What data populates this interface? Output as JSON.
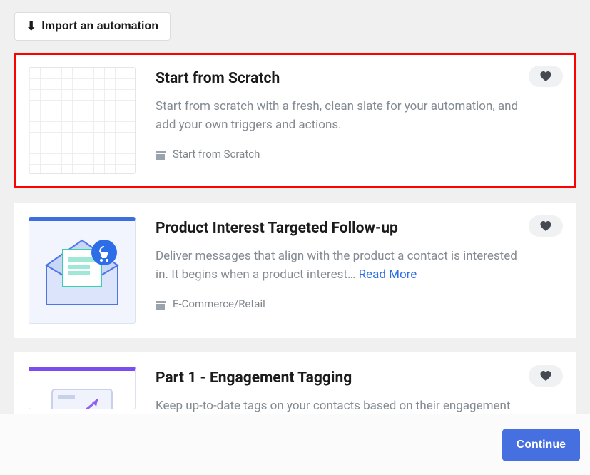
{
  "import_button": "Import an automation",
  "continue_button": "Continue",
  "read_more": "Read More",
  "cards": [
    {
      "title": "Start from Scratch",
      "description": "Start from scratch with a fresh, clean slate for your automation, and add your own triggers and actions.",
      "category": "Start from Scratch"
    },
    {
      "title": "Product Interest Targeted Follow-up",
      "description": "Deliver messages that align with the product a contact is interested in. It begins when a product interest…",
      "category": "E-Commerce/Retail"
    },
    {
      "title": "Part 1 - Engagement Tagging",
      "description": "Keep up-to-date tags on your contacts based on their engagement level"
    }
  ]
}
